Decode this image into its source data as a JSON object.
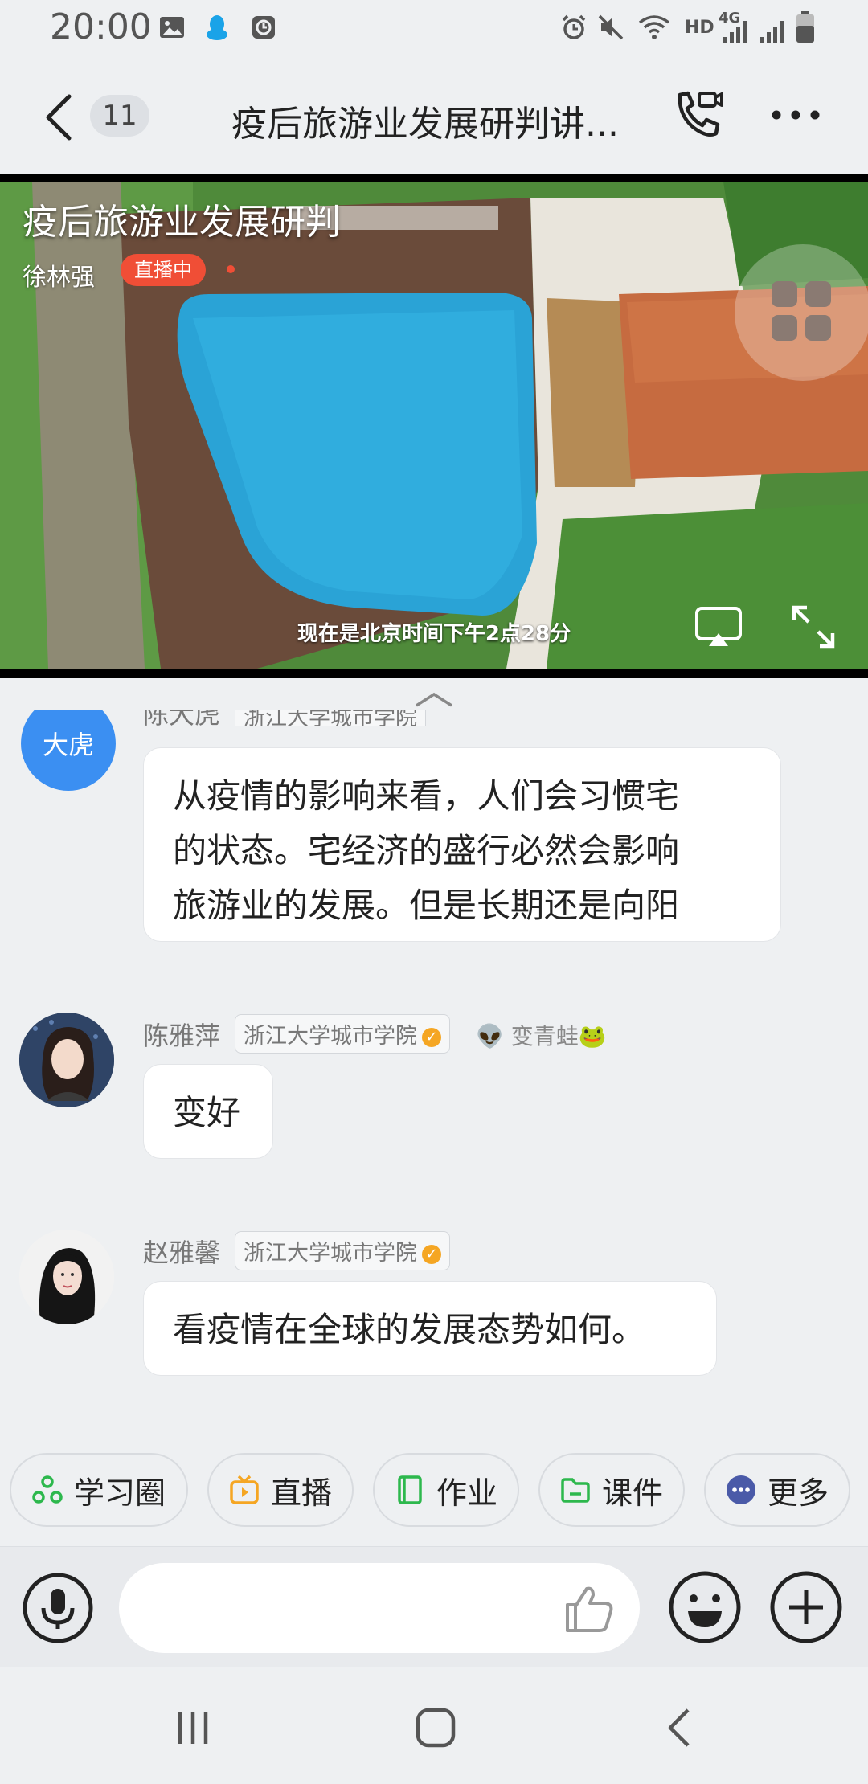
{
  "status_bar": {
    "time": "20:00",
    "network": "HD",
    "signal_type": "4G"
  },
  "header": {
    "back_count": "11",
    "title": "疫后旅游业发展研判讲..."
  },
  "video": {
    "title": "疫后旅游业发展研判",
    "host": "徐林强",
    "live_badge": "直播中",
    "caption": "现在是北京时间下午2点28分"
  },
  "messages": [
    {
      "avatar_text": "大虎",
      "name": "陈大虎",
      "school": "浙江大学城市学院",
      "text_lines": [
        "从疫情的影响来看，人们会习惯宅",
        "的状态。宅经济的盛行必然会影响",
        "旅游业的发展。但是长期还是向阳"
      ]
    },
    {
      "name": "陈雅萍",
      "school": "浙江大学城市学院",
      "extra": "👽 变青蛙🐸",
      "text": "变好"
    },
    {
      "name": "赵雅馨",
      "school": "浙江大学城市学院",
      "text": "看疫情在全球的发展态势如何。"
    }
  ],
  "toolbar": [
    {
      "label": "学习圈",
      "icon": "study-circle-icon",
      "color": "#2db84d"
    },
    {
      "label": "直播",
      "icon": "live-tv-icon",
      "color": "#f5a623"
    },
    {
      "label": "作业",
      "icon": "homework-book-icon",
      "color": "#2db84d"
    },
    {
      "label": "课件",
      "icon": "courseware-folder-icon",
      "color": "#2db84d"
    },
    {
      "label": "更多",
      "icon": "more-dots-icon",
      "color": "#4a5aa8"
    }
  ],
  "input": {
    "placeholder": ""
  },
  "colors": {
    "accent_blue": "#3b8ff2",
    "live_red": "#f04e36",
    "verify_orange": "#f5a623",
    "background": "#eef0f2"
  }
}
